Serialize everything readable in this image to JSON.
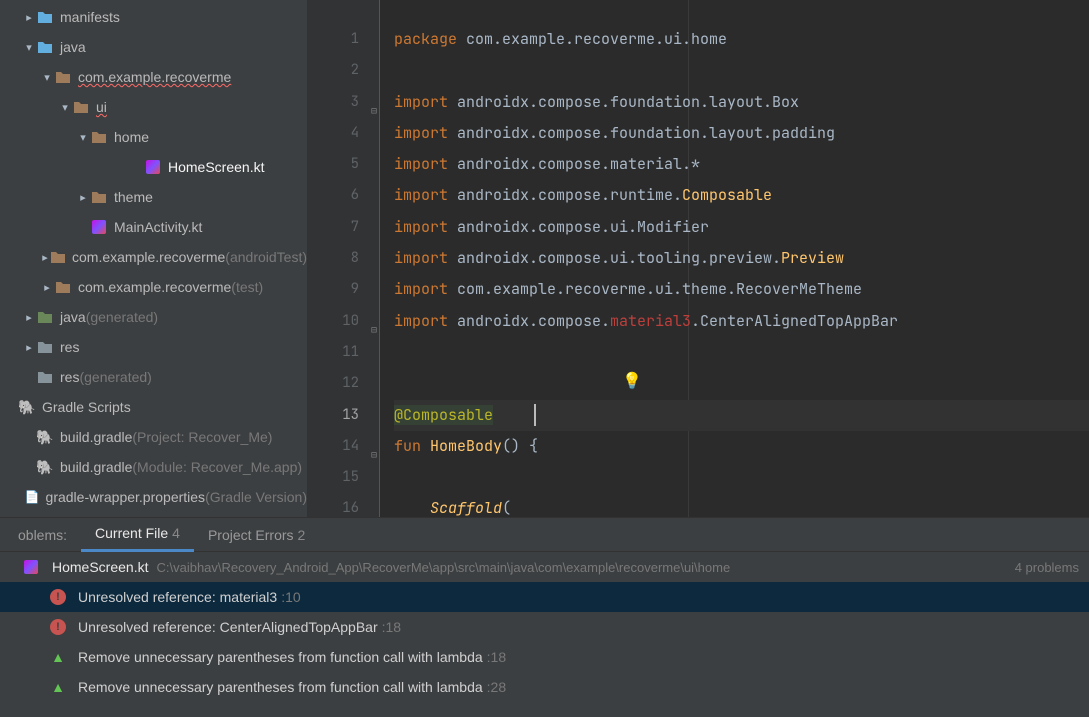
{
  "sidebar": {
    "items": [
      {
        "indent": 1,
        "arrow": "right",
        "icon": "folder-blue",
        "label": "manifests"
      },
      {
        "indent": 1,
        "arrow": "down",
        "icon": "folder-blue",
        "label": "java"
      },
      {
        "indent": 2,
        "arrow": "down",
        "icon": "folder-brown",
        "label": "com.example.recoverme",
        "err": true
      },
      {
        "indent": 3,
        "arrow": "down",
        "icon": "folder-brown",
        "label": "ui",
        "err": true
      },
      {
        "indent": 4,
        "arrow": "down",
        "icon": "folder-brown",
        "label": "home"
      },
      {
        "indent": 6,
        "arrow": "none",
        "icon": "kt",
        "label": "HomeScreen.kt",
        "hl": true
      },
      {
        "indent": 4,
        "arrow": "right",
        "icon": "folder-brown",
        "label": "theme"
      },
      {
        "indent": 4,
        "arrow": "none",
        "icon": "kt",
        "label": "MainActivity.kt"
      },
      {
        "indent": 2,
        "arrow": "right",
        "icon": "folder-brown",
        "label": "com.example.recoverme",
        "suffix": " (androidTest)"
      },
      {
        "indent": 2,
        "arrow": "right",
        "icon": "folder-brown",
        "label": "com.example.recoverme",
        "suffix": " (test)"
      },
      {
        "indent": 1,
        "arrow": "right",
        "icon": "gen",
        "label": "java",
        "suffix": " (generated)"
      },
      {
        "indent": 1,
        "arrow": "right",
        "icon": "folder",
        "label": "res"
      },
      {
        "indent": 1,
        "arrow": "none",
        "icon": "folder",
        "label": "res",
        "suffix": " (generated)"
      },
      {
        "indent": 0,
        "arrow": "none",
        "icon": "gradle",
        "label": "Gradle Scripts"
      },
      {
        "indent": 1,
        "arrow": "none",
        "icon": "gradle",
        "label": "build.gradle",
        "suffix": " (Project: Recover_Me)"
      },
      {
        "indent": 1,
        "arrow": "none",
        "icon": "gradle",
        "label": "build.gradle",
        "suffix": " (Module: Recover_Me.app)"
      },
      {
        "indent": 1,
        "arrow": "none",
        "icon": "prop",
        "label": "gradle-wrapper.properties",
        "suffix": " (Gradle Version)"
      }
    ]
  },
  "editor": {
    "lines": [
      {
        "n": 1,
        "seg": [
          {
            "t": "package ",
            "c": "kw"
          },
          {
            "t": "com.example.recoverme.ui.home",
            "c": "plain"
          }
        ]
      },
      {
        "n": 2,
        "seg": []
      },
      {
        "n": 3,
        "fold": "⊟",
        "seg": [
          {
            "t": "import ",
            "c": "kw"
          },
          {
            "t": "androidx.compose.foundation.layout.Box",
            "c": "plain"
          }
        ]
      },
      {
        "n": 4,
        "seg": [
          {
            "t": "import ",
            "c": "kw"
          },
          {
            "t": "androidx.compose.foundation.layout.padding",
            "c": "plain"
          }
        ]
      },
      {
        "n": 5,
        "seg": [
          {
            "t": "import ",
            "c": "kw"
          },
          {
            "t": "androidx.compose.material.*",
            "c": "plain"
          }
        ]
      },
      {
        "n": 6,
        "seg": [
          {
            "t": "import ",
            "c": "kw"
          },
          {
            "t": "androidx.compose.runtime.",
            "c": "plain"
          },
          {
            "t": "Composable",
            "c": "cls"
          }
        ]
      },
      {
        "n": 7,
        "seg": [
          {
            "t": "import ",
            "c": "kw"
          },
          {
            "t": "androidx.compose.ui.Modifier",
            "c": "plain"
          }
        ]
      },
      {
        "n": 8,
        "seg": [
          {
            "t": "import ",
            "c": "kw"
          },
          {
            "t": "androidx.compose.ui.tooling.preview.",
            "c": "plain"
          },
          {
            "t": "Preview",
            "c": "cls"
          }
        ]
      },
      {
        "n": 9,
        "seg": [
          {
            "t": "import ",
            "c": "kw"
          },
          {
            "t": "com.example.recoverme.ui.theme.RecoverMeTheme",
            "c": "plain"
          }
        ]
      },
      {
        "n": 10,
        "fold": "⊟",
        "seg": [
          {
            "t": "import ",
            "c": "kw"
          },
          {
            "t": "androidx.compose.",
            "c": "plain"
          },
          {
            "t": "material3",
            "c": "err"
          },
          {
            "t": ".CenterAlignedTopAppBar",
            "c": "plain"
          }
        ]
      },
      {
        "n": 11,
        "seg": []
      },
      {
        "n": 12,
        "bulb": true,
        "seg": []
      },
      {
        "n": 13,
        "current": true,
        "seg": [
          {
            "t": "@Composable",
            "c": "ann"
          }
        ]
      },
      {
        "n": 14,
        "fold": "⊟",
        "seg": [
          {
            "t": "fun ",
            "c": "kw"
          },
          {
            "t": "HomeBody",
            "c": "cls"
          },
          {
            "t": "() {",
            "c": "plain"
          }
        ]
      },
      {
        "n": 15,
        "seg": []
      },
      {
        "n": 16,
        "seg": [
          {
            "t": "    ",
            "c": "plain"
          },
          {
            "t": "Scaffold",
            "c": "fn"
          },
          {
            "t": "(",
            "c": "plain"
          }
        ]
      }
    ]
  },
  "problems": {
    "tabs": {
      "label1": "oblems:",
      "currentFile": "Current File",
      "currentFileCount": "4",
      "projectErrors": "Project Errors",
      "projectErrorsCount": "2"
    },
    "header": {
      "fname": "HomeScreen.kt",
      "fpath": "C:\\vaibhav\\Recovery_Android_App\\RecoverMe\\app\\src\\main\\java\\com\\example\\recoverme\\ui\\home",
      "count": "4 problems"
    },
    "rows": [
      {
        "sev": "error",
        "text": "Unresolved reference: material3",
        "loc": ":10",
        "selected": true
      },
      {
        "sev": "error",
        "text": "Unresolved reference: CenterAlignedTopAppBar",
        "loc": ":18"
      },
      {
        "sev": "warn",
        "text": "Remove unnecessary parentheses from function call with lambda",
        "loc": ":18"
      },
      {
        "sev": "warn",
        "text": "Remove unnecessary parentheses from function call with lambda",
        "loc": ":28"
      }
    ]
  }
}
